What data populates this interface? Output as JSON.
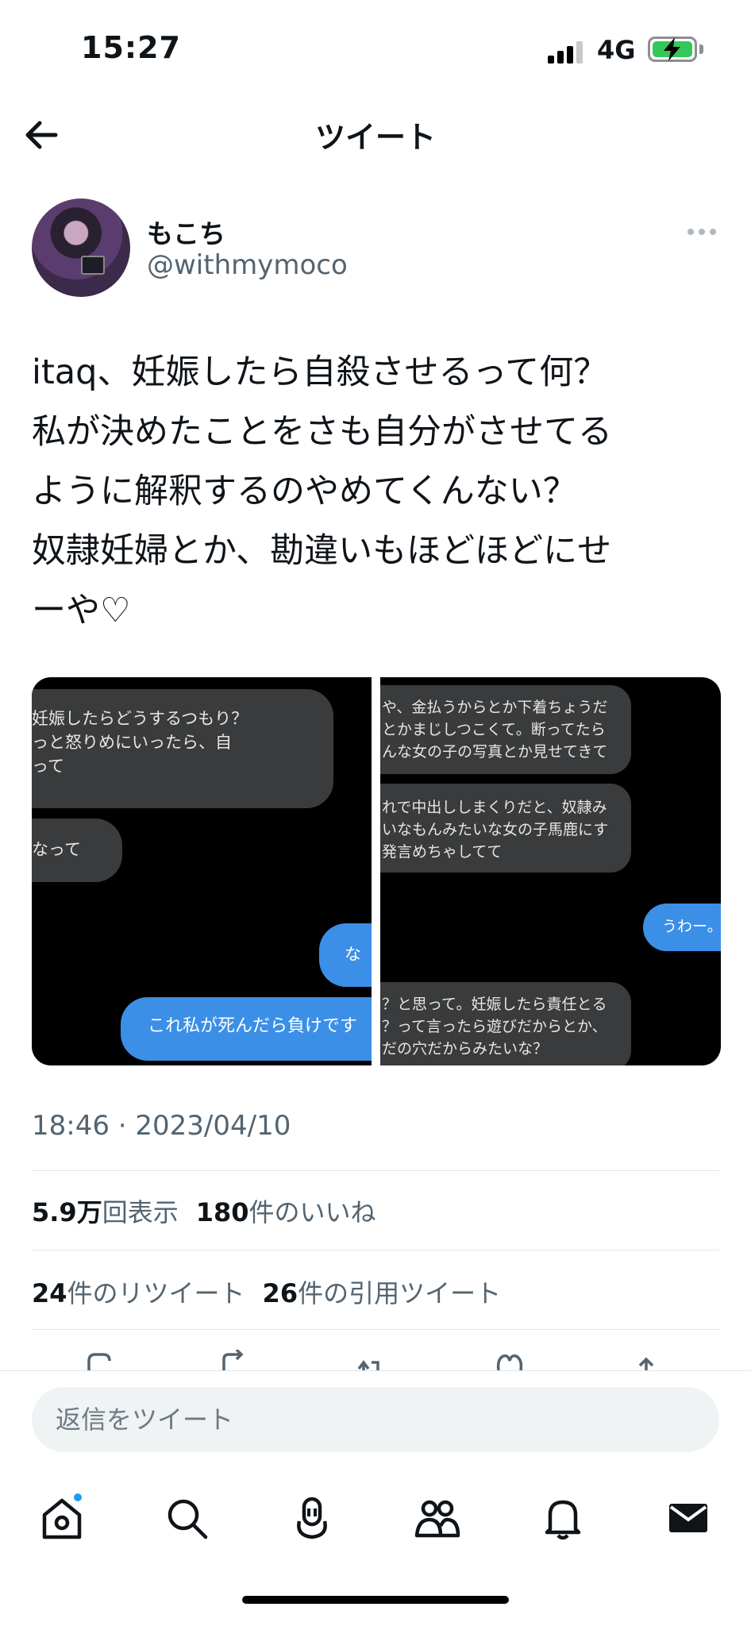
{
  "status_bar": {
    "time": "15:27",
    "network": "4G"
  },
  "header": {
    "title": "ツイート"
  },
  "author": {
    "display_name": "もこち",
    "handle": "@withmymoco"
  },
  "tweet": {
    "text": "itaq、妊娠したら自殺させるって何？\n私が決めたことをさも自分がさせてる\nように解釈するのやめてくんない？\n奴隷妊婦とか、勘違いもほどほどにせ\nーや♡"
  },
  "media": {
    "left_bubbles": [
      {
        "text": "妊娠したらどうするつもり？\nっと怒りめにいったら、自\nって",
        "style": "gray"
      },
      {
        "text": "なって",
        "style": "gray"
      },
      {
        "text": "な",
        "style": "blue"
      },
      {
        "text": "これ私が死んだら負けです",
        "style": "blue"
      }
    ],
    "right_bubbles": [
      {
        "text": "や、金払うからとか下着ちょうだ\nとかまじしつこくて。断ってたら\nんな女の子の写真とか見せてきて",
        "style": "gray"
      },
      {
        "text": "れで中出ししまくりだと、奴隷み\nいなもんみたいな女の子馬鹿にす\n発言めちゃしてて",
        "style": "gray"
      },
      {
        "text": "うわー。",
        "style": "blue"
      },
      {
        "text": "？と思って。妊娠したら責任とる\n？って言ったら遊びだからとか、\nだの穴だからみたいな？",
        "style": "gray"
      }
    ]
  },
  "meta": {
    "timestamp": "18:46 · 2023/04/10",
    "views_value": "5.9万",
    "views_label": "回表示",
    "likes_value": "180",
    "likes_label": "件のいいね",
    "retweets_value": "24",
    "retweets_label": "件のリツイート",
    "quotes_value": "26",
    "quotes_label": "件の引用ツイート"
  },
  "composer": {
    "placeholder": "返信をツイート"
  },
  "icons": [
    "back-arrow-icon",
    "more-icon",
    "reply-icon",
    "retweet-icon",
    "like-icon",
    "share-icon",
    "home-icon",
    "search-icon",
    "spaces-icon",
    "communities-icon",
    "notifications-icon",
    "messages-icon"
  ],
  "colors": {
    "accent": "#1d9bf0",
    "bubble_blue": "#3b8fe6",
    "bubble_gray": "#3a3b3c",
    "secondary_text": "#536471"
  }
}
